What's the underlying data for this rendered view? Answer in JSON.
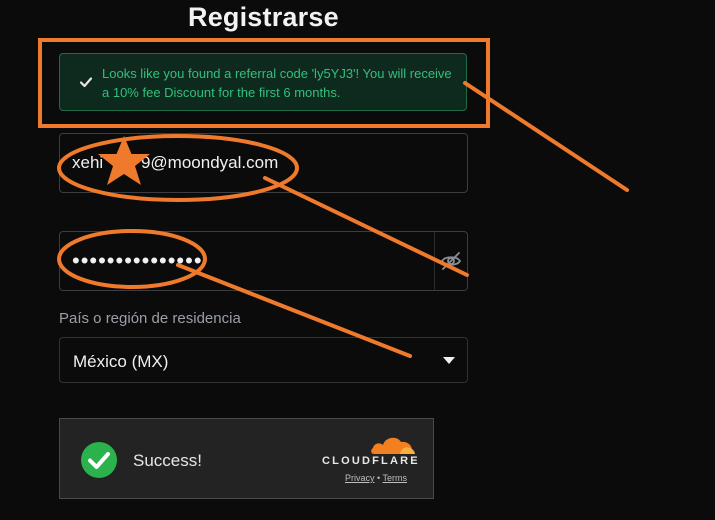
{
  "page": {
    "title": "Registrarse"
  },
  "referral_alert": {
    "message": "Looks like you found a referral code 'ly5YJ3'! You will receive a 10% fee Discount for the first 6 months.",
    "color": "#31c07a"
  },
  "email_field": {
    "value": "xehi        9@moondyal.com"
  },
  "password_field": {
    "value": "•••••••••••••••",
    "toggle_icon": "eye-off-icon"
  },
  "residence": {
    "label": "País o región de residencia",
    "selected": "México (MX)"
  },
  "captcha": {
    "status": "Success!",
    "brand": "CLOUDFLARE",
    "privacy_link": "Privacy",
    "separator": "•",
    "terms_link": "Terms"
  },
  "annotation": {
    "color": "#f07a2b"
  }
}
